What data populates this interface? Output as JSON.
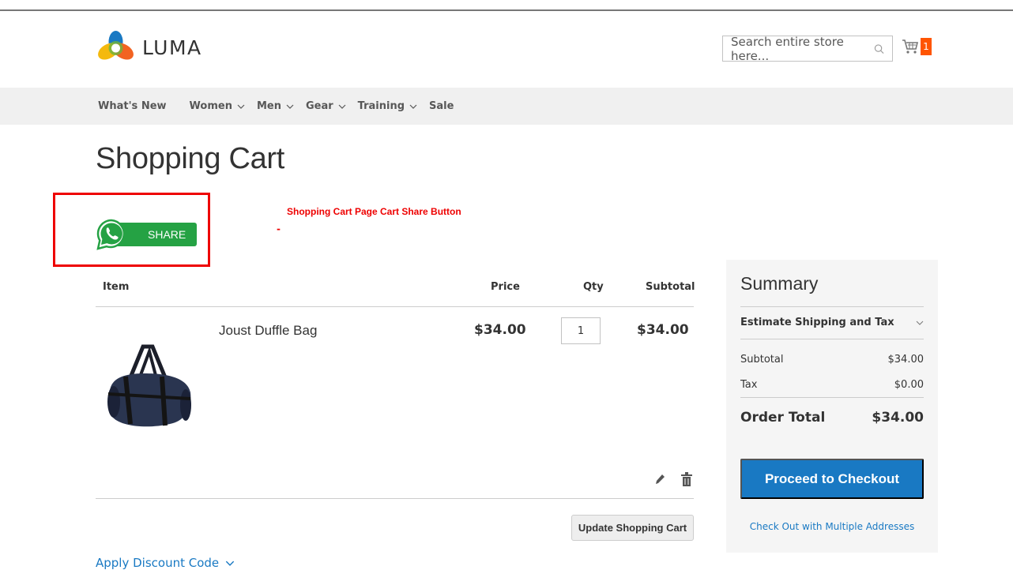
{
  "header": {
    "logo_text": "LUMA",
    "search_placeholder": "Search entire store here...",
    "cart_count": "1"
  },
  "nav": {
    "items": [
      {
        "label": "What's New",
        "has_menu": false
      },
      {
        "label": "Women",
        "has_menu": true
      },
      {
        "label": "Men",
        "has_menu": true
      },
      {
        "label": "Gear",
        "has_menu": true
      },
      {
        "label": "Training",
        "has_menu": true
      },
      {
        "label": "Sale",
        "has_menu": false
      }
    ]
  },
  "page": {
    "title": "Shopping Cart",
    "share_label": "SHARE",
    "annotation": "Shopping Cart Page Cart Share Button",
    "annotation_dash": "-"
  },
  "cart": {
    "headers": {
      "item": "Item",
      "price": "Price",
      "qty": "Qty",
      "subtotal": "Subtotal"
    },
    "items": [
      {
        "name": "Joust Duffle Bag",
        "price": "$34.00",
        "qty": "1",
        "subtotal": "$34.00"
      }
    ],
    "update_label": "Update Shopping Cart",
    "discount_label": "Apply Discount Code"
  },
  "summary": {
    "title": "Summary",
    "estimate_label": "Estimate Shipping and Tax",
    "subtotal_label": "Subtotal",
    "subtotal_value": "$34.00",
    "tax_label": "Tax",
    "tax_value": "$0.00",
    "order_total_label": "Order Total",
    "order_total_value": "$34.00",
    "checkout_label": "Proceed to Checkout",
    "multi_label": "Check Out with Multiple Addresses"
  },
  "colors": {
    "accent": "#1979c3",
    "cart_badge": "#ff5501",
    "whatsapp": "#25a244",
    "annotation": "#e00000"
  }
}
